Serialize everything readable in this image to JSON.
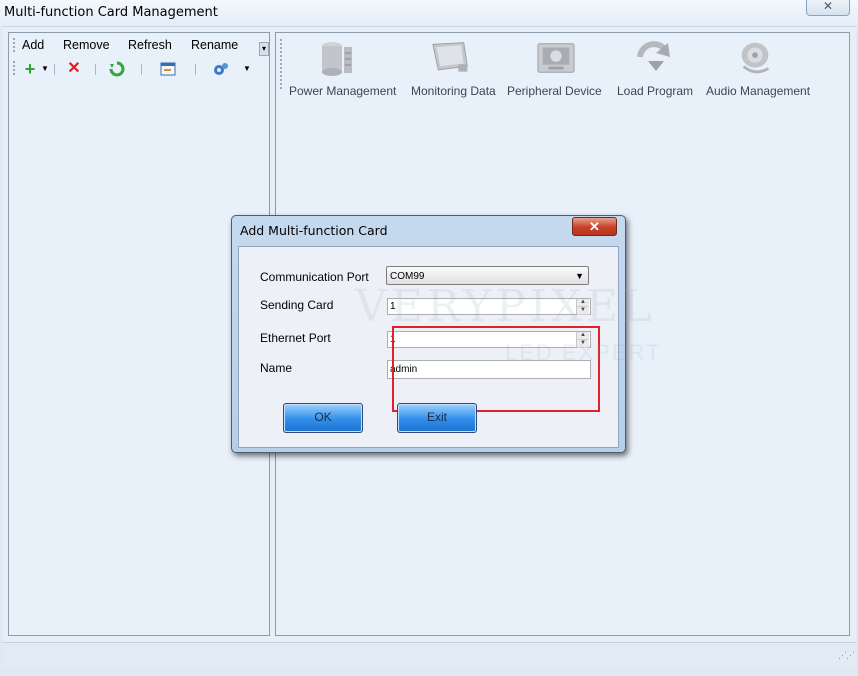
{
  "window": {
    "title": "Multi-function Card Management",
    "close_glyph": "✕"
  },
  "left_pane": {
    "menu": [
      "Add",
      "Remove",
      "Refresh",
      "Rename"
    ],
    "overflow_glyph": "▾",
    "toolbar_icons": [
      "add-icon",
      "delete-icon",
      "refresh-icon",
      "screen-icon",
      "settings-icon"
    ]
  },
  "right_toolbar": {
    "items": [
      {
        "label": "Power Management",
        "icon": "power-icon"
      },
      {
        "label": "Monitoring Data",
        "icon": "monitor-icon"
      },
      {
        "label": "Peripheral Device",
        "icon": "device-icon"
      },
      {
        "label": "Load Program",
        "icon": "load-icon"
      },
      {
        "label": "Audio Management",
        "icon": "audio-icon"
      }
    ]
  },
  "dialog": {
    "title": "Add Multi-function Card",
    "close_glyph": "✕",
    "fields": {
      "comm_port_label": "Communication Port",
      "comm_port_value": "COM99",
      "sending_card_label": "Sending Card",
      "sending_card_value": "1",
      "ethernet_port_label": "Ethernet Port",
      "ethernet_port_value": "1",
      "name_label": "Name",
      "name_value": "admin"
    },
    "ok_label": "OK",
    "exit_label": "Exit"
  },
  "watermark": {
    "line1": "VERYPIXEL",
    "line2": "LED EXPERT"
  },
  "colors": {
    "accent": "#2f8eea",
    "highlight": "#e2202a"
  }
}
